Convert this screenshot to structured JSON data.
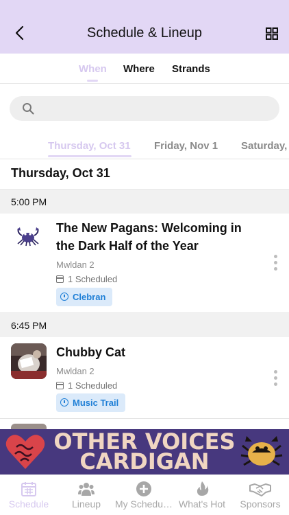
{
  "header": {
    "title": "Schedule & Lineup"
  },
  "subtabs": [
    {
      "label": "When",
      "active": true
    },
    {
      "label": "Where",
      "active": false
    },
    {
      "label": "Strands",
      "active": false
    }
  ],
  "search": {
    "placeholder": ""
  },
  "date_tabs": [
    {
      "label": "Thursday, Oct 31",
      "active": true
    },
    {
      "label": "Friday, Nov 1",
      "active": false
    },
    {
      "label": "Saturday,",
      "active": false
    }
  ],
  "day_header": "Thursday, Oct 31",
  "slots": [
    {
      "time": "5:00 PM",
      "event": {
        "title": "The New Pagans: Welcoming in the Dark Half of the Year",
        "venue": "Mwldan 2",
        "scheduled": "1 Scheduled",
        "tag": "Clebran",
        "thumb_icon": "crab-icon"
      }
    },
    {
      "time": "6:45 PM",
      "event": {
        "title": "Chubby Cat",
        "venue": "Mwldan 2",
        "scheduled": "1 Scheduled",
        "tag": "Music Trail",
        "thumb_icon": "artist-photo"
      }
    }
  ],
  "banner": {
    "line1": "OTHER VOICES",
    "line2": "CARDIGAN"
  },
  "bottom_nav": [
    {
      "label": "Schedule",
      "icon": "calendar-icon",
      "active": true
    },
    {
      "label": "Lineup",
      "icon": "people-icon",
      "active": false
    },
    {
      "label": "My Schedu…",
      "icon": "plus-circle-icon",
      "active": false
    },
    {
      "label": "What's Hot",
      "icon": "flame-icon",
      "active": false
    },
    {
      "label": "Sponsors",
      "icon": "handshake-icon",
      "active": false
    }
  ],
  "colors": {
    "accent_lavender": "#e2d7f5",
    "active_text": "#d6c8ef",
    "tag_bg": "#dbeafa",
    "tag_text": "#1f7fd6",
    "banner_bg": "#47387e"
  }
}
